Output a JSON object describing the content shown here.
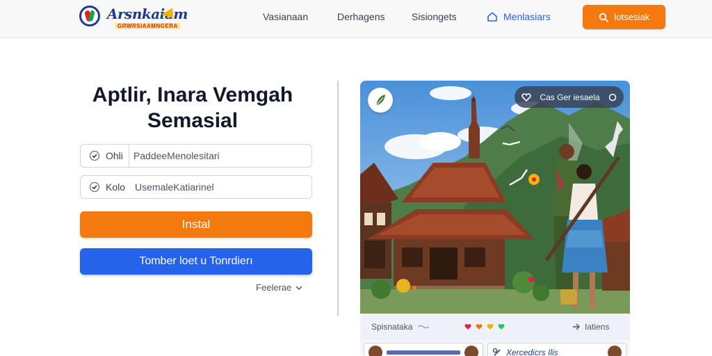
{
  "header": {
    "logo": {
      "name": "Arsnkaiam",
      "tagline": "GRWRSIAAMNGERA"
    },
    "nav": [
      {
        "label": "Vasianaan"
      },
      {
        "label": "Derhagens"
      },
      {
        "label": "Sisiongets"
      },
      {
        "label": "Menlasiars",
        "icon": "home-icon"
      }
    ],
    "search_button": {
      "label": "Iotsesiak",
      "icon": "search-icon"
    }
  },
  "hero": {
    "title_line1": "Aptlir, Inara Vemgah",
    "title_line2": "Semasial"
  },
  "form": {
    "field1": {
      "prefix": "Ohli",
      "placeholder": "PaddeeMenolesitari"
    },
    "field2": {
      "prefix": "Kolo",
      "placeholder": "UsemaleKatiarinel"
    },
    "install_button": "Instal",
    "secondary_button": "Tomber loet u Tonrdierı",
    "more_link": "Feelerae"
  },
  "card": {
    "pill_label": "Cas Ger iesaela",
    "caption": "Spisnataka",
    "share_label": "Iatiens",
    "reaction_colors": [
      "#e11d48",
      "#f97316",
      "#eab308",
      "#22c55e"
    ],
    "mini_right_text": "Xercedicrs Ilis"
  },
  "colors": {
    "accent_orange": "#f47a10",
    "accent_blue": "#2563eb"
  }
}
